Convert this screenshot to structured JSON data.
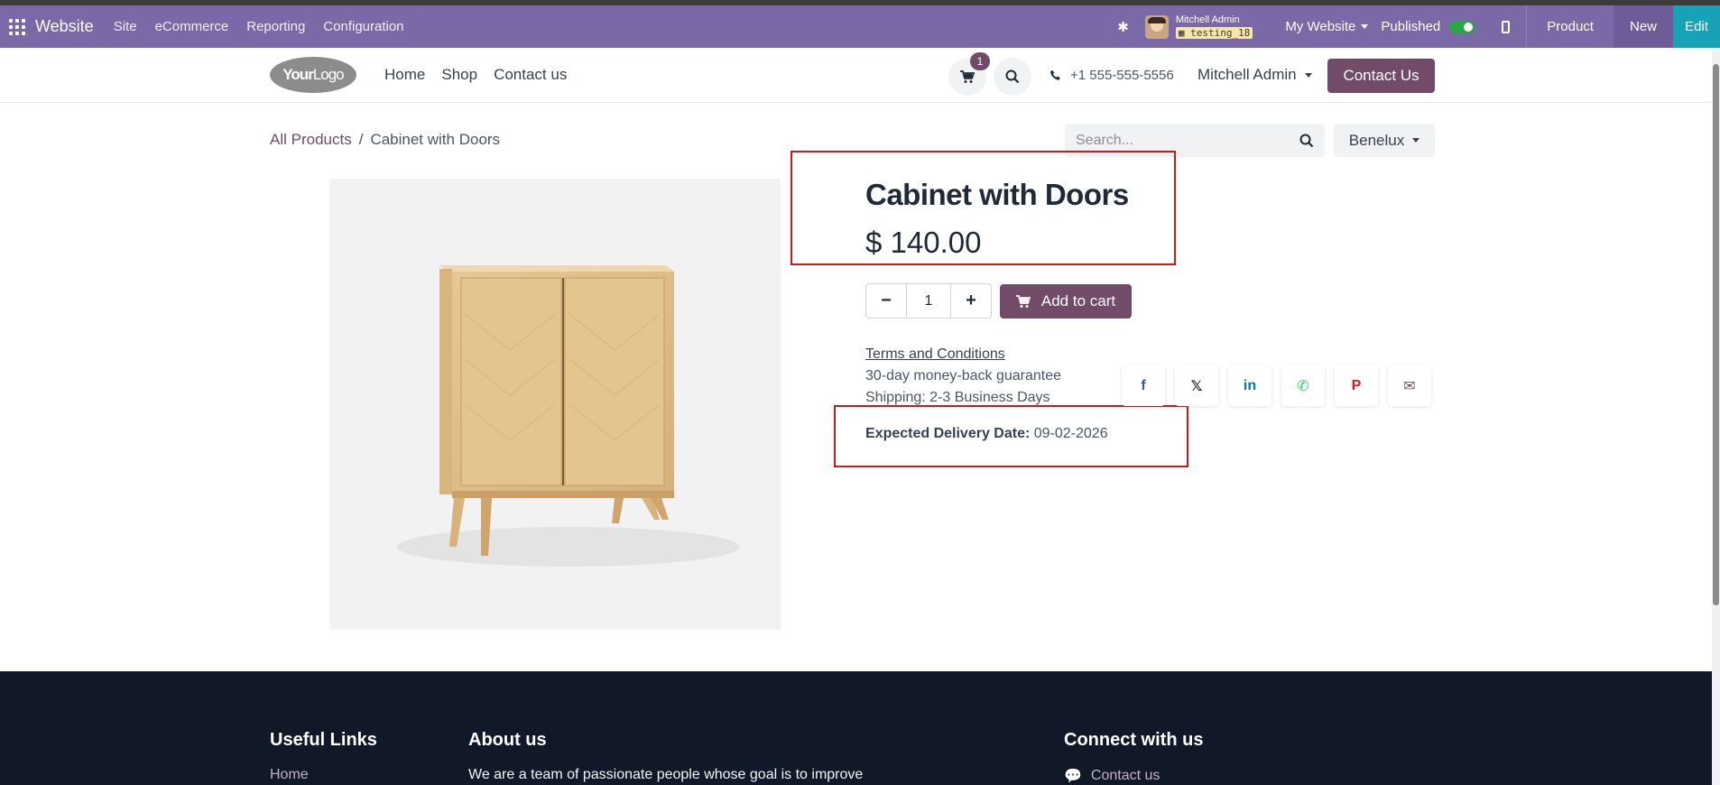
{
  "admin_bar": {
    "app_name": "Website",
    "menus": [
      "Site",
      "eCommerce",
      "Reporting",
      "Configuration"
    ],
    "user_name": "Mitchell Admin",
    "db_badge": "testing_18",
    "website_selector": "My Website",
    "published_label": "Published",
    "published": true,
    "product_button": "Product",
    "new_button": "New",
    "edit_button": "Edit"
  },
  "header": {
    "logo_bold": "Your",
    "logo_rest": "Logo",
    "nav": [
      "Home",
      "Shop",
      "Contact us"
    ],
    "cart_count": "1",
    "phone": "+1 555-555-5556",
    "user": "Mitchell Admin",
    "contact_button": "Contact Us"
  },
  "breadcrumb": {
    "parent": "All Products",
    "separator": "/",
    "current": "Cabinet with Doors"
  },
  "search": {
    "placeholder": "Search...",
    "pricelist": "Benelux"
  },
  "product": {
    "name": "Cabinet with Doors",
    "price": "$ 140.00",
    "quantity": "1",
    "add_to_cart": "Add to cart",
    "terms": "Terms and Conditions",
    "guarantee": "30-day money-back guarantee",
    "shipping": "Shipping: 2-3 Business Days",
    "delivery_label": "Expected Delivery Date:",
    "delivery_date": " 09-02-2026"
  },
  "share": [
    {
      "icon": "facebook-icon",
      "glyph": "f",
      "color": "#3b5998"
    },
    {
      "icon": "x-twitter-icon",
      "glyph": "𝕏",
      "color": "#111111"
    },
    {
      "icon": "linkedin-icon",
      "glyph": "in",
      "color": "#0077b5"
    },
    {
      "icon": "whatsapp-icon",
      "glyph": "✆",
      "color": "#25d366"
    },
    {
      "icon": "pinterest-icon",
      "glyph": "P",
      "color": "#cb2027"
    },
    {
      "icon": "email-icon",
      "glyph": "✉",
      "color": "#714b67"
    }
  ],
  "footer": {
    "useful_links_title": "Useful Links",
    "useful_links_first": "Home",
    "about_title": "About us",
    "about_text": "We are a team of passionate people whose goal is to improve",
    "connect_title": "Connect with us",
    "connect_first": "Contact us"
  },
  "colors": {
    "admin_bar": "#7b68a6",
    "brand_primary": "#714b67",
    "edit_button": "#17a2b8",
    "annotation": "#cc1a1a",
    "footer": "#111827"
  }
}
